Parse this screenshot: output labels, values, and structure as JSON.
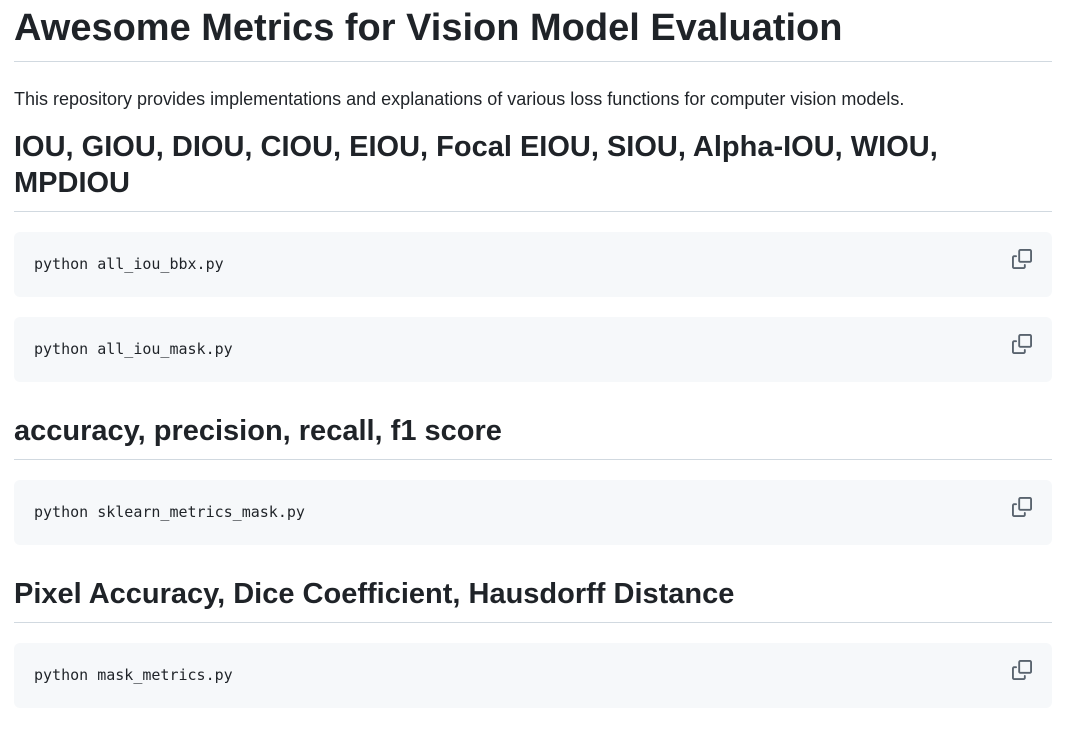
{
  "readme": {
    "title": "Awesome Metrics for Vision Model Evaluation",
    "intro": "This repository provides implementations and explanations of various loss functions for computer vision models.",
    "sections": [
      {
        "heading": "IOU, GIOU, DIOU, CIOU, EIOU, Focal EIOU, SIOU, Alpha-IOU, WIOU, MPDIOU",
        "code_blocks": [
          "python all_iou_bbx.py",
          "python all_iou_mask.py"
        ]
      },
      {
        "heading": "accuracy, precision, recall, f1 score",
        "code_blocks": [
          "python sklearn_metrics_mask.py"
        ]
      },
      {
        "heading": "Pixel Accuracy, Dice Coefficient, Hausdorff Distance",
        "code_blocks": [
          "python mask_metrics.py"
        ]
      }
    ],
    "copy_icon": "copy-icon",
    "colors": {
      "text": "#1f2328",
      "code_bg": "#f6f8fa",
      "divider": "#d1d9e0",
      "icon": "#59636e"
    }
  }
}
